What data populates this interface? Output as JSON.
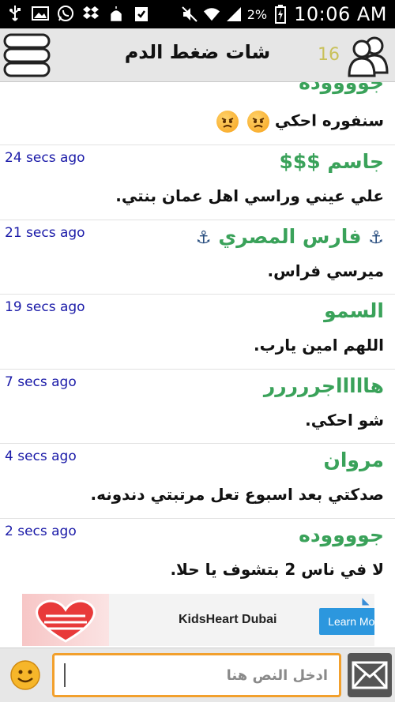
{
  "status_bar": {
    "battery_percent": "2%",
    "time": "10:06 AM",
    "left_icons": [
      "usb-icon",
      "image-icon",
      "whatsapp-icon",
      "dropbox-icon",
      "mosque-icon",
      "clipboard-check-icon"
    ],
    "right_icons": [
      "mute-icon",
      "wifi-icon",
      "signal-icon",
      "battery-charging-icon"
    ]
  },
  "header": {
    "title": "شات ضغط الدم",
    "users_count": "16",
    "menu_icon": "stacked-menu-icon",
    "users_icon": "users-icon"
  },
  "messages": [
    {
      "sender": "جووووده",
      "time": "",
      "text": "سنفوره احكي",
      "emojis": 2
    },
    {
      "sender": "جاسم $$$",
      "time": "24 secs ago",
      "text": "علي عيني وراسي اهل عمان بنتي."
    },
    {
      "sender": "فارس المصري",
      "time": "21 secs ago",
      "text": "ميرسي فراس.",
      "anchors": true
    },
    {
      "sender": "السمو",
      "time": "19 secs ago",
      "text": "اللهم امين يارب."
    },
    {
      "sender": "هاااااجررررر",
      "time": "7 secs ago",
      "text": "شو احكي."
    },
    {
      "sender": "مروان",
      "time": "4 secs ago",
      "text": "صدكتي بعد اسبوع تعل مرتبتي دندونه."
    },
    {
      "sender": "جووووده",
      "time": "2 secs ago",
      "text": "لا في ناس 2 بتشوف يا حلا."
    }
  ],
  "ad": {
    "brand": "KidsHeart Dubai",
    "cta": "Learn More"
  },
  "composer": {
    "placeholder": "ادخل النص هنا",
    "value": ""
  },
  "colors": {
    "sender": "#3aa25a",
    "timestamp": "#1a1aa8",
    "input_border": "#f2a02d",
    "ad_button": "#2c97de"
  }
}
